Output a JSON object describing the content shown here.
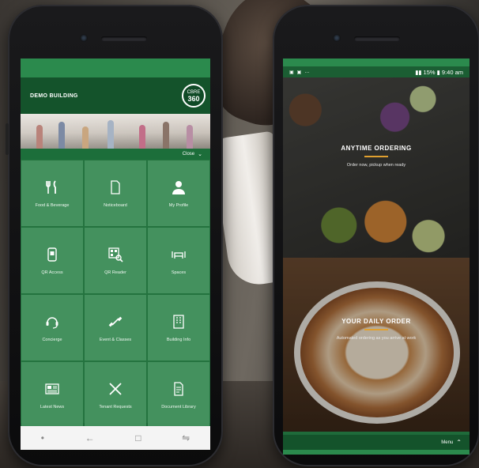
{
  "left_app": {
    "building_name": "DEMO BUILDING",
    "logo_text": "CBRE",
    "logo_number": "360",
    "close_label": "Close",
    "tiles": [
      {
        "label": "Food & Beverage",
        "icon": "fork-knife-icon"
      },
      {
        "label": "Noticeboard",
        "icon": "document-icon"
      },
      {
        "label": "My Profile",
        "icon": "person-icon"
      },
      {
        "label": "QR Access",
        "icon": "qr-phone-icon"
      },
      {
        "label": "QR Reader",
        "icon": "qr-scan-icon"
      },
      {
        "label": "Spaces",
        "icon": "meeting-table-icon"
      },
      {
        "label": "Concierge",
        "icon": "headset-icon"
      },
      {
        "label": "Event & Classes",
        "icon": "dumbbell-icon"
      },
      {
        "label": "Building Info",
        "icon": "building-icon"
      },
      {
        "label": "Latest News",
        "icon": "newspaper-icon"
      },
      {
        "label": "Tenant Requests",
        "icon": "tools-icon"
      },
      {
        "label": "Document Library",
        "icon": "file-icon"
      }
    ]
  },
  "right_app": {
    "status": {
      "battery": "15%",
      "time": "9:40 am"
    },
    "panels": [
      {
        "title": "ANYTIME ORDERING",
        "subtitle": "Order now, pickup when ready"
      },
      {
        "title": "YOUR DAILY ORDER",
        "subtitle": "Automated ordering as you arrive at work"
      }
    ],
    "menu_label": "Menu"
  },
  "colors": {
    "brand_green": "#14532b",
    "tile_green": "#4a9664",
    "accent": "#e0a030"
  }
}
